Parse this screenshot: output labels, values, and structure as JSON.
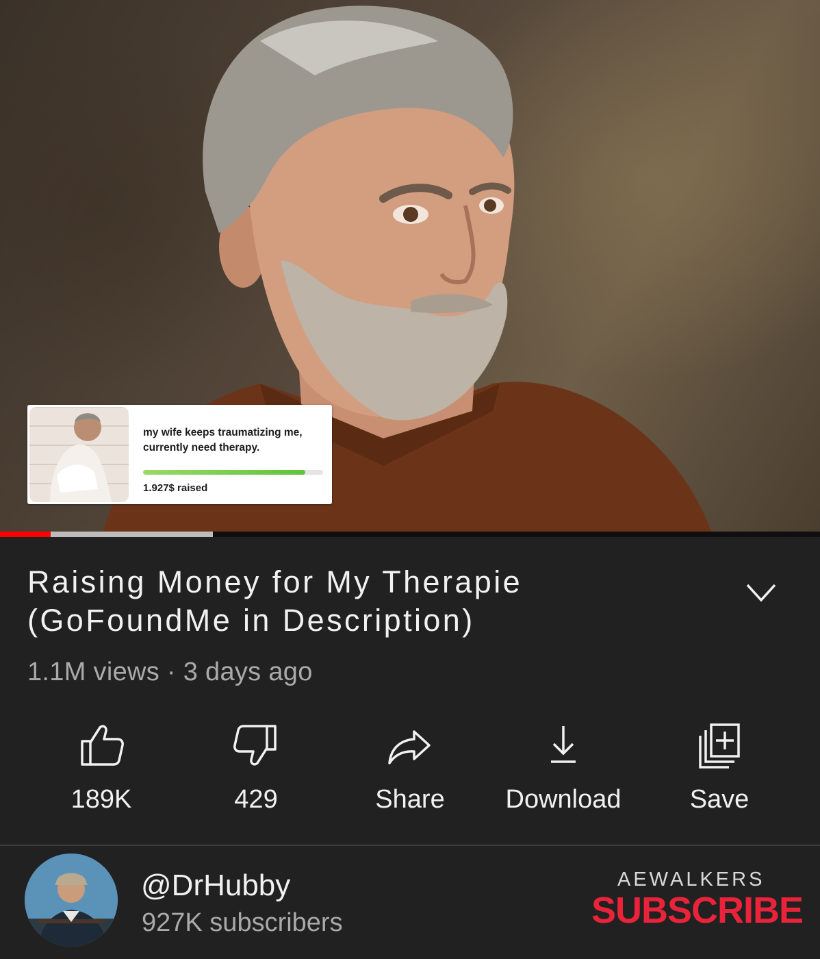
{
  "video": {
    "overlay": {
      "text": "my wife keeps traumatizing me, currently need therapy.",
      "progress_fraction": 0.9,
      "raised": "1.927$ raised"
    },
    "progress": {
      "played_fraction": 0.062,
      "buffered_fraction": 0.26
    }
  },
  "details": {
    "title": "Raising Money for My Therapie (GoFoundMe in Description)",
    "meta": "1.1M views · 3 days ago"
  },
  "actions": {
    "like": {
      "label": "189K",
      "icon": "thumb-up-icon"
    },
    "dislike": {
      "label": "429",
      "icon": "thumb-down-icon"
    },
    "share": {
      "label": "Share",
      "icon": "share-icon"
    },
    "download": {
      "label": "Download",
      "icon": "download-icon"
    },
    "save": {
      "label": "Save",
      "icon": "add-to-playlist-icon"
    }
  },
  "channel": {
    "name": "@DrHubby",
    "subscribers": "927K subscribers",
    "watermark": "AEWALKERS",
    "subscribe_label": "SUBSCRIBE"
  },
  "colors": {
    "background": "#212121",
    "progress_played": "#ff0000",
    "subscribe": "#e8233a",
    "overlay_progress": "#61c23a"
  }
}
